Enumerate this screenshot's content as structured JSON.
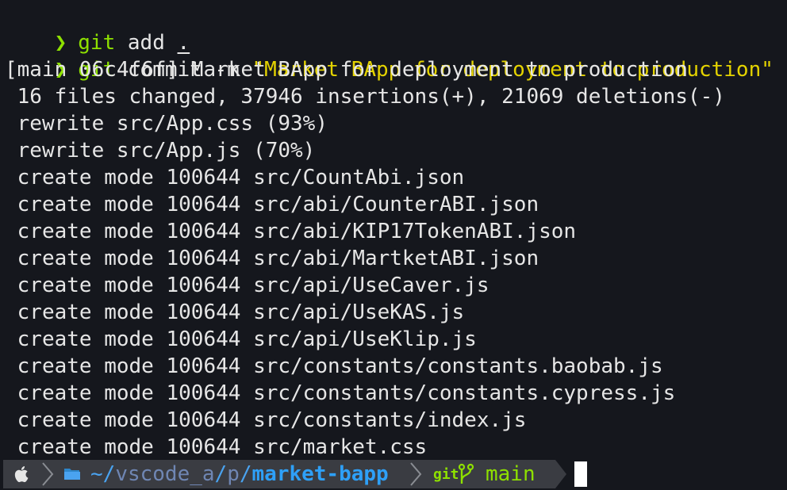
{
  "colors": {
    "background": "#15171d",
    "text": "#e6e6e6",
    "prompt_green": "#8ee000",
    "string_yellow": "#e4d300",
    "path_blue": "#2ea0f8",
    "statusbar_bg": "#3a3c42"
  },
  "commands": [
    {
      "prompt": "❯",
      "program": "git",
      "args": "add",
      "arg2": "."
    },
    {
      "prompt": "❯",
      "program": "git",
      "args": "commit -m",
      "arg2": "\"Market BApp for deployment to production\""
    }
  ],
  "output": [
    "[main 06c4f6f] Market BApp for deployment to production",
    " 16 files changed, 37946 insertions(+), 21069 deletions(-)",
    " rewrite src/App.css (93%)",
    " rewrite src/App.js (70%)",
    " create mode 100644 src/CountAbi.json",
    " create mode 100644 src/abi/CounterABI.json",
    " create mode 100644 src/abi/KIP17TokenABI.json",
    " create mode 100644 src/abi/MartketABI.json",
    " create mode 100644 src/api/UseCaver.js",
    " create mode 100644 src/api/UseKAS.js",
    " create mode 100644 src/api/UseKlip.js",
    " create mode 100644 src/constants/constants.baobab.js",
    " create mode 100644 src/constants/constants.cypress.js",
    " create mode 100644 src/constants/index.js",
    " create mode 100644 src/market.css"
  ],
  "statusbar": {
    "os_icon": "apple-icon",
    "folder_icon": "folder-icon",
    "path_home": "~/",
    "path_mid1": "vscode_a",
    "path_sep1": "/",
    "path_mid2": "p",
    "path_sep2": "/",
    "path_current": "market-bapp",
    "git_label": "git",
    "branch_icon": "git-branch-icon",
    "branch": "main"
  }
}
